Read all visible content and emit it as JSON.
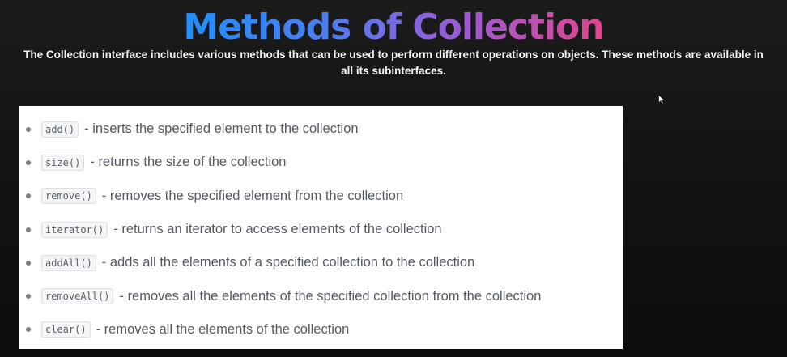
{
  "slide": {
    "title": "Methods of Collection",
    "subtitle": "The Collection interface includes various methods that can be used to perform different operations on objects. These methods are available in all its subinterfaces."
  },
  "methods": [
    {
      "code": "add()",
      "description": "- inserts the specified element to the collection"
    },
    {
      "code": "size()",
      "description": "- returns the size of the collection"
    },
    {
      "code": "remove()",
      "description": "- removes the specified element from the collection"
    },
    {
      "code": "iterator()",
      "description": "- returns an iterator to access elements of the collection"
    },
    {
      "code": "addAll()",
      "description": "- adds all the elements of a specified collection to the collection"
    },
    {
      "code": "removeAll()",
      "description": "- removes all the elements of the specified collection from the collection"
    },
    {
      "code": "clear()",
      "description": "- removes all the elements of the collection"
    }
  ],
  "colors": {
    "title_gradient_start": "#1e90ff",
    "title_gradient_end": "#e0458f",
    "background": "#141414",
    "card": "#ffffff"
  },
  "icons": {
    "cursor": "mouse-pointer-icon"
  }
}
